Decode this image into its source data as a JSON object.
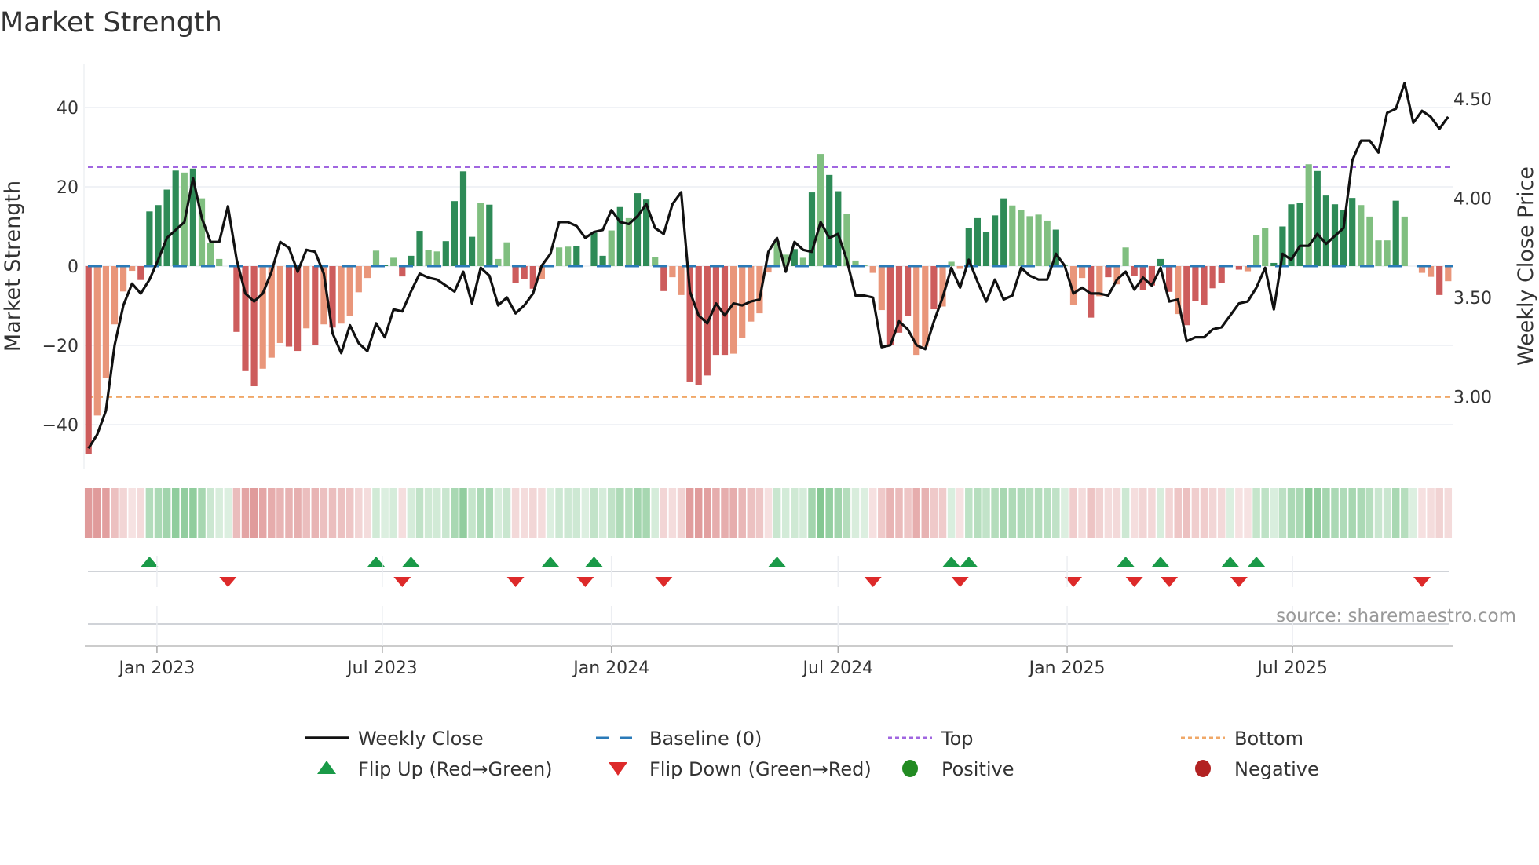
{
  "chart_data": {
    "type": "bar",
    "title": "Market Strength",
    "ylabel": "Market Strength",
    "y2label": "Weekly Close Price",
    "ylim": [
      -50,
      52
    ],
    "y2lim": [
      2.63,
      4.67
    ],
    "frequency": "weekly",
    "start_date": "2022-11-07",
    "yticks": [
      {
        "v": 40,
        "label": "40"
      },
      {
        "v": 20,
        "label": "20"
      },
      {
        "v": 0,
        "label": "0"
      },
      {
        "v": -20,
        "label": "−20"
      },
      {
        "v": -40,
        "label": "−40"
      }
    ],
    "y2ticks": [
      {
        "v": 4.5,
        "label": "4.50"
      },
      {
        "v": 4.0,
        "label": "4.00"
      },
      {
        "v": 3.5,
        "label": "3.50"
      },
      {
        "v": 3.0,
        "label": "3.00"
      }
    ],
    "xticks": [
      {
        "date": "2023-01-01",
        "label": "Jan 2023"
      },
      {
        "date": "2023-07-01",
        "label": "Jul 2023"
      },
      {
        "date": "2024-01-01",
        "label": "Jan 2024"
      },
      {
        "date": "2024-07-01",
        "label": "Jul 2024"
      },
      {
        "date": "2025-01-01",
        "label": "Jan 2025"
      },
      {
        "date": "2025-07-01",
        "label": "Jul 2025"
      }
    ],
    "top_level": 25,
    "bottom_level": -33,
    "baseline": 0,
    "strength": [
      -47.4,
      -37.7,
      -28.2,
      -14.7,
      -6.4,
      -1.2,
      -3.5,
      13.8,
      15.4,
      19.3,
      24.1,
      23.6,
      24.6,
      17.1,
      5.9,
      1.8,
      0,
      -16.6,
      -26.5,
      -30.3,
      -25.9,
      -23.1,
      -19.4,
      -20.3,
      -21.4,
      -15.7,
      -19.9,
      -14.7,
      -15.5,
      -14.5,
      -12.6,
      -6.6,
      -3.0,
      3.9,
      0.3,
      2.1,
      -2.6,
      2.6,
      8.9,
      4.1,
      3.7,
      6.3,
      16.4,
      23.9,
      7.4,
      15.9,
      15.5,
      1.8,
      6.0,
      -4.3,
      -3.2,
      -5.7,
      -3.2,
      0,
      4.7,
      4.9,
      5.1,
      0,
      8.4,
      2.6,
      9.0,
      14.9,
      12.1,
      18.4,
      16.8,
      2.3,
      -6.3,
      -2.8,
      -7.3,
      -29.3,
      -29.9,
      -27.6,
      -22.4,
      -22.4,
      -22.1,
      -18.2,
      -14.0,
      -11.9,
      -1.6,
      6.4,
      2.9,
      4.3,
      2.1,
      18.6,
      28.3,
      23.0,
      18.9,
      13.2,
      1.4,
      0.3,
      -1.7,
      -11.1,
      -19.8,
      -16.8,
      -12.6,
      -22.4,
      -20.3,
      -10.9,
      -10.2,
      1.1,
      -0.7,
      9.7,
      12.1,
      8.6,
      12.8,
      17.1,
      15.3,
      14.1,
      12.6,
      13.0,
      11.5,
      9.2,
      0.3,
      -9.7,
      -3.0,
      -13.0,
      -7.6,
      -2.8,
      -4.6,
      4.7,
      -2.5,
      -6.0,
      -4.9,
      1.8,
      -6.5,
      -12.1,
      -14.9,
      -8.8,
      -9.9,
      -5.6,
      -4.2,
      0,
      -0.9,
      -1.3,
      7.9,
      9.7,
      0.8,
      10.0,
      15.6,
      16.0,
      25.7,
      24.0,
      17.8,
      15.6,
      14.1,
      17.2,
      15.4,
      12.5,
      6.5,
      6.5,
      16.5,
      12.5,
      0,
      -1.7,
      -2.7,
      -7.3,
      -3.8
    ],
    "shade": "dllllldddddldlllldddlllddldldllllldldddllddddldlldddldllddddldlddldlldddddllllllldldlddllllldddlldllldddddllllldllldldlldddddldddddldlllddddldddddlllldlllldlddddl",
    "weekly_close": [
      2.74,
      2.81,
      2.93,
      3.26,
      3.46,
      3.57,
      3.52,
      3.59,
      3.69,
      3.8,
      3.84,
      3.88,
      4.1,
      3.9,
      3.78,
      3.78,
      3.96,
      3.69,
      3.52,
      3.48,
      3.52,
      3.63,
      3.78,
      3.75,
      3.63,
      3.74,
      3.73,
      3.62,
      3.32,
      3.22,
      3.36,
      3.27,
      3.23,
      3.37,
      3.3,
      3.44,
      3.43,
      3.53,
      3.62,
      3.6,
      3.59,
      3.56,
      3.53,
      3.63,
      3.47,
      3.65,
      3.61,
      3.46,
      3.5,
      3.42,
      3.46,
      3.52,
      3.66,
      3.72,
      3.88,
      3.88,
      3.86,
      3.8,
      3.83,
      3.84,
      3.94,
      3.88,
      3.87,
      3.91,
      3.97,
      3.85,
      3.82,
      3.97,
      4.03,
      3.53,
      3.41,
      3.37,
      3.47,
      3.41,
      3.47,
      3.46,
      3.48,
      3.49,
      3.73,
      3.8,
      3.63,
      3.78,
      3.74,
      3.73,
      3.88,
      3.8,
      3.82,
      3.69,
      3.51,
      3.51,
      3.5,
      3.25,
      3.26,
      3.38,
      3.34,
      3.26,
      3.24,
      3.38,
      3.5,
      3.65,
      3.55,
      3.69,
      3.58,
      3.48,
      3.59,
      3.49,
      3.51,
      3.65,
      3.61,
      3.59,
      3.59,
      3.72,
      3.66,
      3.52,
      3.55,
      3.52,
      3.52,
      3.51,
      3.59,
      3.63,
      3.54,
      3.6,
      3.56,
      3.65,
      3.48,
      3.49,
      3.28,
      3.3,
      3.3,
      3.34,
      3.35,
      3.41,
      3.47,
      3.48,
      3.55,
      3.65,
      3.44,
      3.72,
      3.69,
      3.76,
      3.76,
      3.82,
      3.77,
      3.81,
      3.85,
      4.19,
      4.29,
      4.29,
      4.23,
      4.43,
      4.45,
      4.58,
      4.38,
      4.44,
      4.41,
      4.35,
      4.41
    ],
    "flip_up_weeks": [
      8,
      34,
      38,
      54,
      59,
      80,
      100,
      102,
      120,
      124,
      132,
      135
    ],
    "flip_down_weeks": [
      17,
      37,
      50,
      58,
      67,
      91,
      101,
      114,
      121,
      125,
      133,
      154
    ],
    "legend": [
      {
        "label": "Weekly Close",
        "icon": "line-solid",
        "color": "#111111"
      },
      {
        "label": "Baseline (0)",
        "icon": "line-dashed",
        "color": "#2a7ab8"
      },
      {
        "label": "Top",
        "icon": "line-dotted",
        "color": "#a066e0"
      },
      {
        "label": "Bottom",
        "icon": "line-dotted",
        "color": "#f0a868"
      },
      {
        "label": "Flip Up (Red→Green)",
        "icon": "triangle-up",
        "color": "#1a9a48"
      },
      {
        "label": "Flip Down (Green→Red)",
        "icon": "triangle-down",
        "color": "#dd2a2a"
      },
      {
        "label": "Positive",
        "icon": "circle",
        "color": "#228b22"
      },
      {
        "label": "Negative",
        "icon": "circle",
        "color": "#b22222"
      }
    ],
    "legend_position": "bottom-center",
    "source": "source: sharemaestro.com",
    "colors": {
      "pos_dark": "#2e8b57",
      "pos_light": "#80bf80",
      "neg_dark": "#cd5c5c",
      "neg_light": "#e9967a",
      "strip_pos": "46,160,70",
      "strip_neg": "205,92,92",
      "grid": "#ebeef4",
      "axis": "#cccccc"
    }
  }
}
